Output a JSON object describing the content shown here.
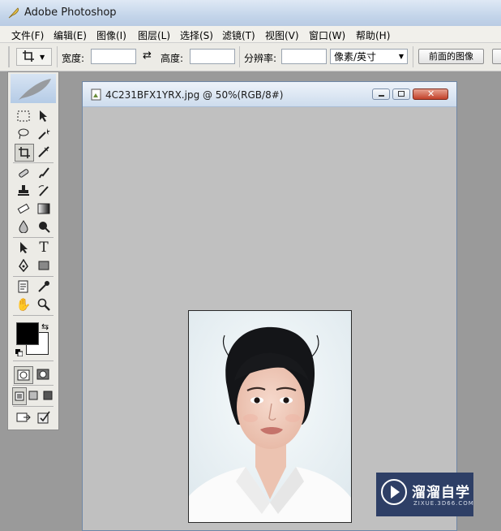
{
  "app": {
    "title": "Adobe Photoshop"
  },
  "menu": {
    "items": [
      "文件(F)",
      "编辑(E)",
      "图像(I)",
      "图层(L)",
      "选择(S)",
      "滤镜(T)",
      "视图(V)",
      "窗口(W)",
      "帮助(H)"
    ]
  },
  "options_bar": {
    "tool_icon": "crop-icon",
    "width_label": "宽度:",
    "width_value": "",
    "swap_icon": "swap-arrows-icon",
    "height_label": "高度:",
    "height_value": "",
    "resolution_label": "分辨率:",
    "resolution_value": "",
    "unit_selected": "像素/英寸",
    "front_image_button": "前面的图像"
  },
  "document": {
    "title": "4C231BFX1YRX.jpg @ 50%(RGB/8#)",
    "zoom": "50%",
    "color_mode": "RGB/8#"
  },
  "toolbox": {
    "foreground_color": "#000000",
    "background_color": "#ffffff"
  },
  "watermark": {
    "text_cn": "溜溜自学",
    "text_url": "ZIXUE.3D66.COM"
  },
  "colors": {
    "titlebar": "#c4d5ea",
    "panel": "#ecebe6",
    "workspace": "#9a9a9a",
    "canvas_bg": "#c0c0c0",
    "watermark_bg": "#2e3f66"
  }
}
